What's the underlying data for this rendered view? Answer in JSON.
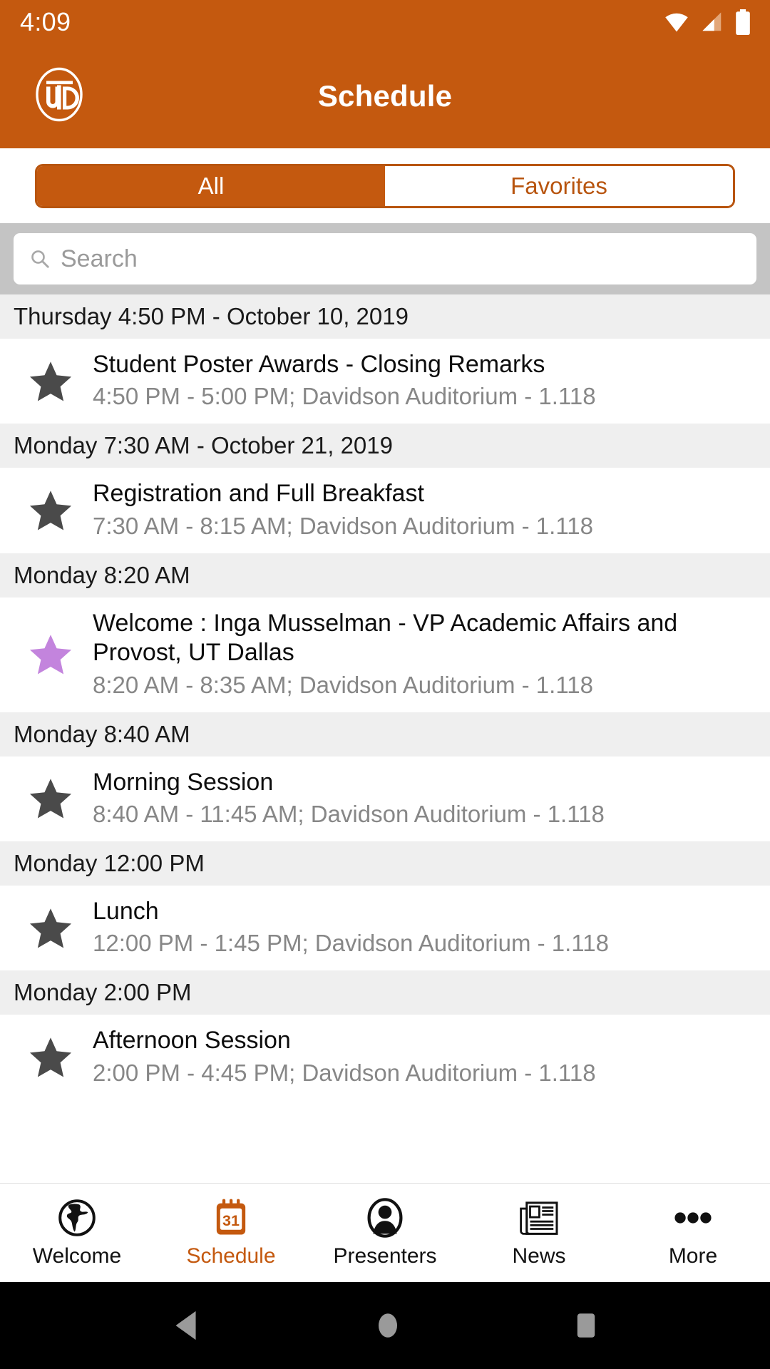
{
  "status_bar": {
    "time": "4:09",
    "icons": [
      "wifi-icon",
      "cellular-signal-icon",
      "battery-icon"
    ]
  },
  "app_bar": {
    "title": "Schedule",
    "logo": "utd-logo",
    "background_color": "#C4590F"
  },
  "segmented_control": {
    "options": [
      {
        "label": "All",
        "selected": true
      },
      {
        "label": "Favorites",
        "selected": false
      }
    ],
    "accent_color": "#C4590F"
  },
  "search": {
    "placeholder": "Search",
    "value": "",
    "icon": "search-icon"
  },
  "schedule": {
    "groups": [
      {
        "header": "Thursday 4:50 PM - October 10, 2019",
        "events": [
          {
            "title": "Student Poster Awards - Closing Remarks",
            "details": "4:50 PM - 5:00 PM; Davidson Auditorium - 1.118",
            "favorited": false,
            "star_color": "#4a4a4a"
          }
        ]
      },
      {
        "header": "Monday 7:30 AM - October 21, 2019",
        "events": [
          {
            "title": "Registration and Full Breakfast",
            "details": "7:30 AM - 8:15 AM; Davidson Auditorium - 1.118",
            "favorited": false,
            "star_color": "#4a4a4a"
          }
        ]
      },
      {
        "header": "Monday 8:20 AM",
        "events": [
          {
            "title": "Welcome : Inga Musselman - VP Academic Affairs and Provost, UT Dallas",
            "details": "8:20 AM - 8:35 AM; Davidson Auditorium - 1.118",
            "favorited": true,
            "star_color": "#C384DD"
          }
        ]
      },
      {
        "header": "Monday 8:40 AM",
        "events": [
          {
            "title": "Morning Session",
            "details": "8:40 AM - 11:45 AM; Davidson Auditorium - 1.118",
            "favorited": false,
            "star_color": "#4a4a4a"
          }
        ]
      },
      {
        "header": "Monday 12:00 PM",
        "events": [
          {
            "title": "Lunch",
            "details": "12:00 PM - 1:45 PM; Davidson Auditorium - 1.118",
            "favorited": false,
            "star_color": "#4a4a4a"
          }
        ]
      },
      {
        "header": "Monday 2:00 PM",
        "events": [
          {
            "title": "Afternoon Session",
            "details": "2:00 PM - 4:45 PM; Davidson Auditorium - 1.118",
            "favorited": false,
            "star_color": "#4a4a4a"
          }
        ]
      }
    ]
  },
  "bottom_nav": {
    "active_color": "#C4590F",
    "items": [
      {
        "label": "Welcome",
        "icon": "globe-icon",
        "active": false
      },
      {
        "label": "Schedule",
        "icon": "calendar-icon",
        "active": true,
        "badge": "31"
      },
      {
        "label": "Presenters",
        "icon": "person-icon",
        "active": false
      },
      {
        "label": "News",
        "icon": "newspaper-icon",
        "active": false
      },
      {
        "label": "More",
        "icon": "ellipsis-icon",
        "active": false
      }
    ]
  },
  "system_nav": {
    "buttons": [
      "back-icon",
      "home-icon",
      "recents-icon"
    ]
  }
}
